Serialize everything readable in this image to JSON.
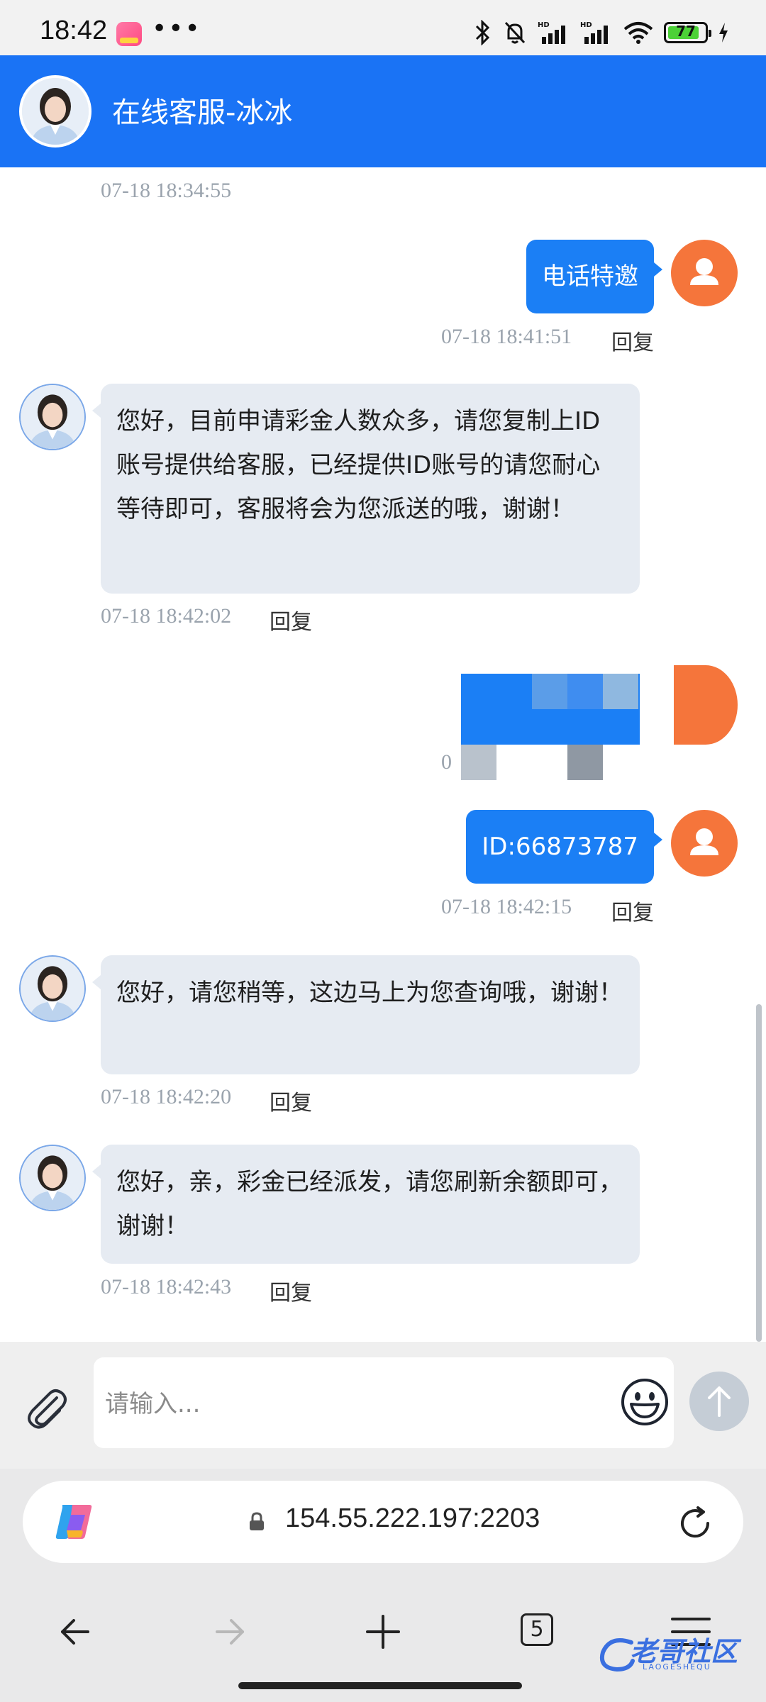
{
  "status_bar": {
    "time": "18:42",
    "more": "•••",
    "battery": "77",
    "icons": [
      "bluetooth-icon",
      "bell-muted-icon",
      "hd-signal-icon",
      "hd-signal-icon",
      "wifi-icon",
      "battery-icon",
      "charging-icon"
    ]
  },
  "header": {
    "title": "在线客服-冰冰"
  },
  "chat": {
    "top_timestamp": "07-18 18:34:55",
    "reply_label": "回复",
    "messages": [
      {
        "side": "right",
        "text": "电话特邀",
        "time": "07-18 18:41:51"
      },
      {
        "side": "left",
        "text": "您好，目前申请彩金人数众多，请您复制上ID账号提供给客服，已经提供ID账号的请您耐心等待即可，客服将会为您派送的哦，谢谢！",
        "time": "07-18 18:42:02"
      },
      {
        "side": "right",
        "text": "",
        "time": "0",
        "pixelated": true
      },
      {
        "side": "right",
        "text": "ID:66873787",
        "time": "07-18 18:42:15"
      },
      {
        "side": "left",
        "text": "您好，请您稍等，这边马上为您查询哦，谢谢！",
        "time": "07-18 18:42:20"
      },
      {
        "side": "left",
        "text": "您好，亲，彩金已经派发，请您刷新余额即可，谢谢！",
        "time": "07-18 18:42:43"
      }
    ]
  },
  "composer": {
    "placeholder": "请输入..."
  },
  "browser": {
    "url": "154.55.222.197:2203",
    "tab_count": "5"
  },
  "watermark": {
    "text": "老哥社区",
    "sub": "LAOGESHEQU"
  },
  "colors": {
    "header": "#1a73f5",
    "user_bubble": "#1b7ff5",
    "agent_bubble": "#e6ebf2",
    "user_avatar": "#f5753b"
  }
}
